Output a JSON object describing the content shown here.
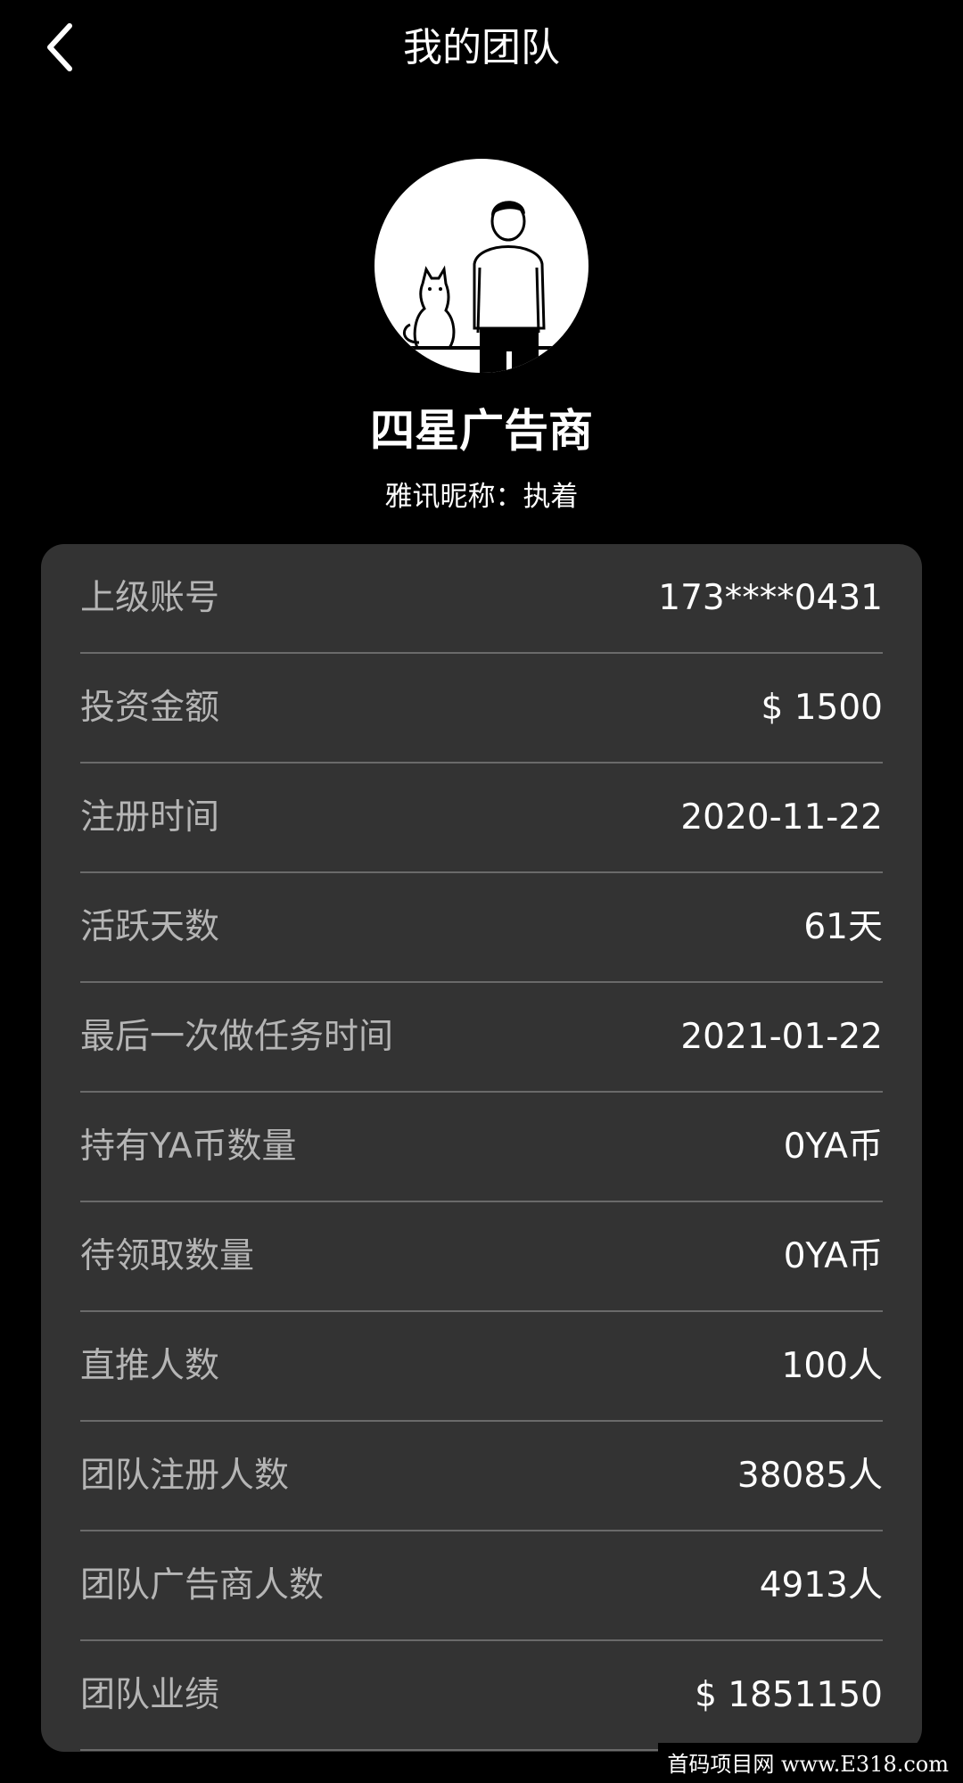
{
  "header": {
    "title": "我的团队",
    "back_icon": "chevron-left-icon"
  },
  "profile": {
    "level": "四星广告商",
    "nickname": "雅讯昵称：执着"
  },
  "info_rows": [
    {
      "label": "上级账号",
      "value": "173****0431"
    },
    {
      "label": "投资金额",
      "value": "$ 1500"
    },
    {
      "label": "注册时间",
      "value": "2020-11-22"
    },
    {
      "label": "活跃天数",
      "value": "61天"
    },
    {
      "label": "最后一次做任务时间",
      "value": "2021-01-22"
    },
    {
      "label": "持有YA币数量",
      "value": "0YA币"
    },
    {
      "label": "待领取数量",
      "value": "0YA币"
    },
    {
      "label": "直推人数",
      "value": "100人"
    },
    {
      "label": "团队注册人数",
      "value": "38085人"
    },
    {
      "label": "团队广告商人数",
      "value": "4913人"
    },
    {
      "label": "团队业绩",
      "value": "$ 1851150"
    }
  ],
  "watermark": "首码项目网 www.E318.com",
  "colors": {
    "background": "#000000",
    "card": "#333333",
    "label": "#b5b5b5",
    "divider": "#6a6a6a"
  }
}
